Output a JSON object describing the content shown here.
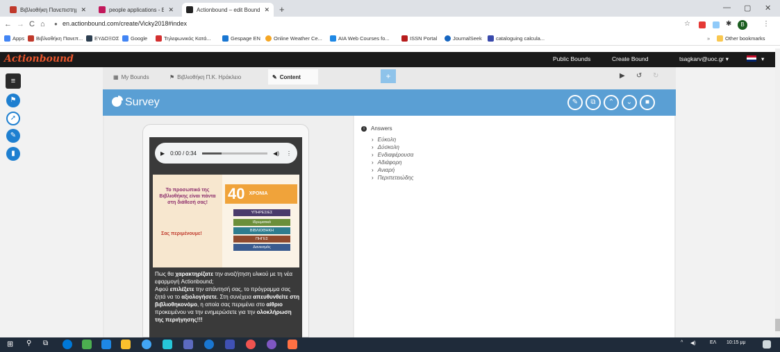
{
  "browser": {
    "tabs": [
      {
        "label": "Βιβλιοθήκη Πανεπιστημίου Κρήτ",
        "icon": "library-favicon",
        "color": "#c0392b"
      },
      {
        "label": "people applications - Edit - Word",
        "icon": "word-favicon",
        "color": "#c2185b"
      },
      {
        "label": "Actionbound – edit Bound | Crea",
        "icon": "actionbound-favicon",
        "color": "#222222"
      }
    ],
    "new_tab": "+",
    "url": "en.actionbound.com/create/Vicky2018#index",
    "bookmarks": [
      {
        "label": "Apps",
        "color": "#4285f4"
      },
      {
        "label": "Βιβλιοθήκη Πανεπ...",
        "color": "#c0392b"
      },
      {
        "label": "ΕΥΔΟΞΟΣ",
        "color": "#2c3e50"
      },
      {
        "label": "Google",
        "color": "#4285f4"
      },
      {
        "label": "Τηλεφωνικός Κατά...",
        "color": "#d32f2f"
      },
      {
        "label": "Gespage EN",
        "color": "#1976d2"
      },
      {
        "label": "Online Weather Ce...",
        "color": "#f5a623"
      },
      {
        "label": "AIA Web Courses fo...",
        "color": "#1e88e5"
      },
      {
        "label": "ISSN Portal",
        "color": "#b71c1c"
      },
      {
        "label": "JournalSeek",
        "color": "#1565c0"
      },
      {
        "label": "cataloguing calcula...",
        "color": "#3949ab"
      }
    ],
    "other_bookmarks": "Other bookmarks",
    "bookmarks_overflow": "»"
  },
  "app": {
    "logo": "Actionbound",
    "nav": {
      "public_bounds": "Public Bounds",
      "create_bound": "Create Bound",
      "user": "tsagkarv@uoc.gr ▾"
    },
    "breadcrumb": {
      "my_bounds": "My Bounds",
      "bound": "Βιβλιοθήκη Π.Κ. Ηράκλειο",
      "content": "Content"
    },
    "panel": {
      "title": "Survey",
      "audio_time": "0:00 / 0:34",
      "poster": {
        "left_text": "Το προσωπικό της Βιβλιοθήκης είναι πάντα στη διάθεσή σας!",
        "wait_text": "Σας περιμένουμε!",
        "years": "40",
        "years_label": "ΧΡΟΝΙΑ",
        "service": "ΥΠΗΡΕΣΙΕΣ",
        "books": [
          "Ιδρυματικό",
          "ΒΙΒΛΙΟΘΗΚΗ",
          "ΠΗΓΕΣ",
          "Δανεισμός"
        ]
      },
      "description": {
        "p1": "Πως θα ",
        "p1b": "χαρακτηρίζατε",
        "p1c": " την αναζήτηση υλικού με τη νέα εφαρμογή Actionbound;",
        "p2": "Αφού ",
        "p2b": "επιλέξετε",
        "p2c": " την απάντησή σας, το πρόγραμμα σας ζητά να το ",
        "p2d": "αξιολογήσετε",
        "p2e": ". Στη συνέχεια ",
        "p2f": "απευθυνθείτε στη βιβλιοθηκονόμο",
        "p2g": ", η οποία σας περιμένει στο ",
        "p2h": "αίθριο",
        "p2i": " προκειμένου να την ενημερώσετε για την ",
        "p2j": "ολοκλήρωση της περιήγησης!!!"
      },
      "answers_label": "Answers",
      "answers": [
        "Εύκολη",
        "Δύσκολη",
        "Ενδιαφέρουσα",
        "Αδιάφορη",
        "Ανιαρή",
        "Περιπετειώδης"
      ]
    }
  },
  "taskbar": {
    "lang": "ΕΛ",
    "time": "10:15 μμ"
  }
}
